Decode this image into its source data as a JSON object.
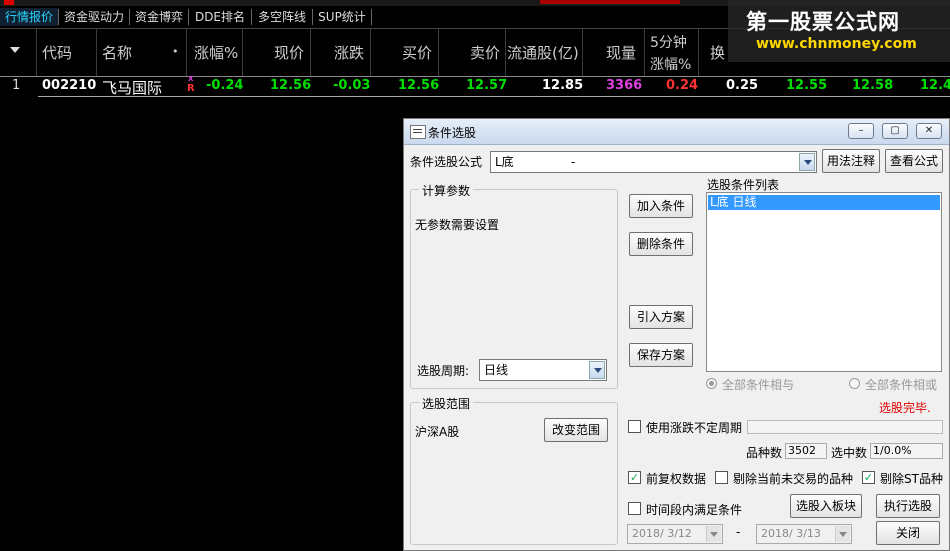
{
  "colors": {
    "tab_active": "#2ad6ff",
    "up": "#ff3333",
    "down": "#00e000",
    "volume": "#e040e0",
    "status_red": "#e00000"
  },
  "tabs": [
    "行情报价",
    "资金驱动力",
    "资金博弈",
    "DDE排名",
    "多空阵线",
    "SUP统计"
  ],
  "watermark": {
    "line1": "第一股票公式网",
    "line2": "www.chnmoney.com"
  },
  "columns": [
    "代码",
    "名称",
    "•",
    "涨幅%",
    "现价",
    "涨跌",
    "买价",
    "卖价",
    "流通股(亿)",
    "现量",
    "5分钟",
    "涨幅%",
    "换"
  ],
  "row": {
    "index": "1",
    "code": "002210",
    "name": "飞马国际",
    "flag_top": "X",
    "flag_bot": "R",
    "change_pct": "-0.24",
    "price": "12.56",
    "change": "-0.03",
    "bid": "12.56",
    "ask": "12.57",
    "float_shares": "12.85",
    "volume": "3366",
    "five_min": "0.24",
    "turnover": "0.25",
    "col_a": "12.55",
    "col_b": "12.58",
    "col_c": "12.4"
  },
  "dialog": {
    "title": "条件选股",
    "formula_label": "条件选股公式",
    "formula_value": "L底",
    "formula_desc": "-",
    "btn_usage": "用法注释",
    "btn_view": "查看公式",
    "calc_group": "计算参数",
    "no_params": "无参数需要设置",
    "period_label": "选股周期:",
    "period_value": "日线",
    "btn_add": "加入条件",
    "btn_delete": "删除条件",
    "btn_import": "引入方案",
    "btn_save": "保存方案",
    "list_label": "选股条件列表",
    "list_items": [
      "L底    日线"
    ],
    "radio_and": "全部条件相与",
    "radio_or": "全部条件相或",
    "status": "选股完毕.",
    "range_group": "选股范围",
    "range_value": "沪深A股",
    "btn_change_range": "改变范围",
    "chk_period": "使用涨跌不定周期",
    "count_label": "品种数",
    "count_value": "3502",
    "selected_label": "选中数",
    "selected_value": "1/0.0%",
    "chk_prefuq": "前复权数据",
    "chk_untraded": "剔除当前未交易的品种",
    "chk_st": "剔除ST品种",
    "chk_timerange": "时间段内满足条件",
    "btn_to_block": "选股入板块",
    "btn_run": "执行选股",
    "btn_close": "关闭",
    "date_from": "2018/ 3/12",
    "date_sep": "-",
    "date_to": "2018/ 3/13"
  }
}
